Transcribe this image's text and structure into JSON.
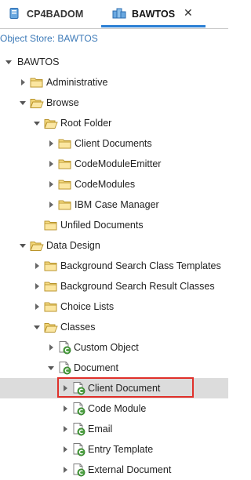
{
  "tabs": [
    {
      "label": "CP4BADOM",
      "icon": "object-store-icon",
      "active": false
    },
    {
      "label": "BAWTOS",
      "icon": "object-store-icon",
      "active": true,
      "close": "✕"
    }
  ],
  "store_label": "Object Store: BAWTOS",
  "tree": [
    {
      "label": "BAWTOS",
      "level": 0,
      "state": "expanded",
      "icon": "none"
    },
    {
      "label": "Administrative",
      "level": 1,
      "state": "collapsed",
      "icon": "folder-icon"
    },
    {
      "label": "Browse",
      "level": 1,
      "state": "expanded",
      "icon": "open-folder-icon"
    },
    {
      "label": "Root Folder",
      "level": 2,
      "state": "expanded",
      "icon": "open-folder-icon"
    },
    {
      "label": "Client Documents",
      "level": 3,
      "state": "collapsed",
      "icon": "folder-icon"
    },
    {
      "label": "CodeModuleEmitter",
      "level": 3,
      "state": "collapsed",
      "icon": "folder-icon"
    },
    {
      "label": "CodeModules",
      "level": 3,
      "state": "collapsed",
      "icon": "folder-icon"
    },
    {
      "label": "IBM Case Manager",
      "level": 3,
      "state": "collapsed",
      "icon": "folder-icon"
    },
    {
      "label": "Unfiled Documents",
      "level": 2,
      "state": "leaf",
      "icon": "folder-icon"
    },
    {
      "label": "Data Design",
      "level": 1,
      "state": "expanded",
      "icon": "open-folder-icon"
    },
    {
      "label": "Background Search Class Templates",
      "level": 2,
      "state": "collapsed",
      "icon": "folder-icon"
    },
    {
      "label": "Background Search Result Classes",
      "level": 2,
      "state": "collapsed",
      "icon": "folder-icon"
    },
    {
      "label": "Choice Lists",
      "level": 2,
      "state": "collapsed",
      "icon": "folder-icon"
    },
    {
      "label": "Classes",
      "level": 2,
      "state": "expanded",
      "icon": "open-folder-icon"
    },
    {
      "label": "Custom Object",
      "level": 3,
      "state": "collapsed",
      "icon": "class-icon"
    },
    {
      "label": "Document",
      "level": 3,
      "state": "expanded",
      "icon": "class-icon"
    },
    {
      "label": "Client Document",
      "level": 4,
      "state": "collapsed",
      "icon": "class-icon",
      "selected": true
    },
    {
      "label": "Code Module",
      "level": 4,
      "state": "collapsed",
      "icon": "class-icon"
    },
    {
      "label": "Email",
      "level": 4,
      "state": "collapsed",
      "icon": "class-icon"
    },
    {
      "label": "Entry Template",
      "level": 4,
      "state": "collapsed",
      "icon": "class-icon"
    },
    {
      "label": "External Document",
      "level": 4,
      "state": "collapsed",
      "icon": "class-icon"
    }
  ]
}
